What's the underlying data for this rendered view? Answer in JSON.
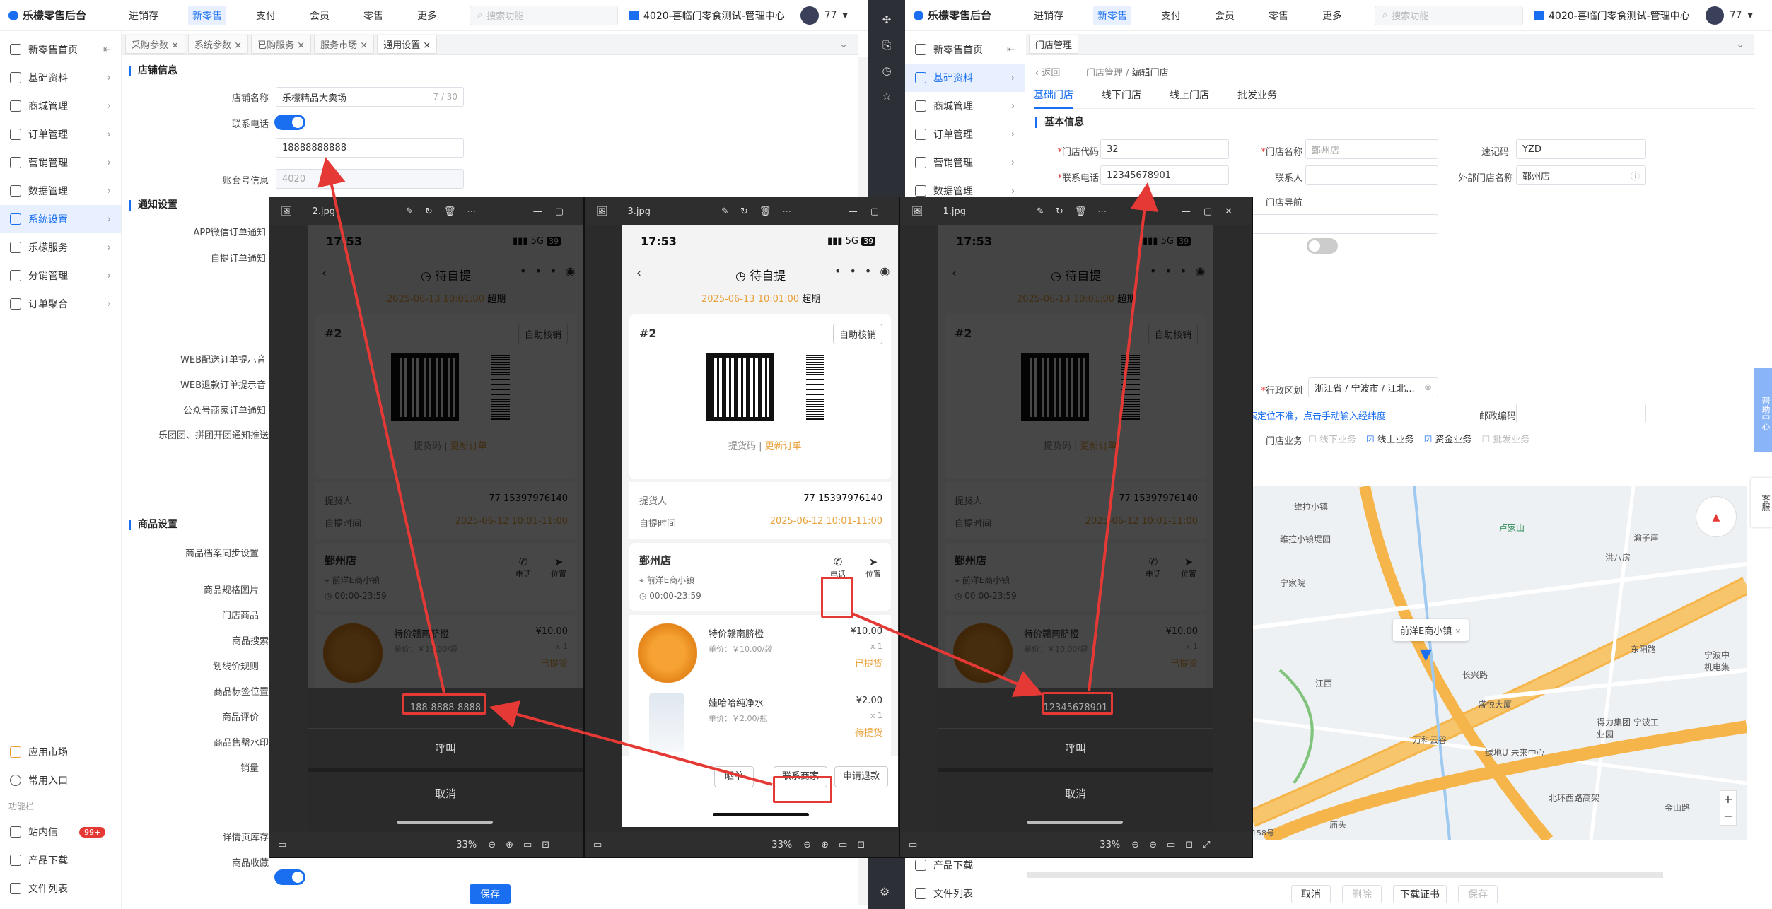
{
  "app": {
    "name": "乐檬零售后台"
  },
  "left_panel": {
    "nav": [
      "进销存",
      "新零售",
      "支付",
      "会员",
      "零售",
      "更多"
    ],
    "nav_active": 1,
    "search_placeholder": "搜索功能",
    "store": "4020-喜临门零食测试-管理中心",
    "user_count": "77",
    "sidebar": [
      "新零售首页",
      "基础资料",
      "商城管理",
      "订单管理",
      "营销管理",
      "数据管理",
      "系统设置",
      "乐檬服务",
      "分销管理",
      "订单聚合"
    ],
    "sidebar_active": 6,
    "sidebar_bottom": [
      "应用市场",
      "常用入口"
    ],
    "func_label": "功能栏",
    "func_items": [
      "站内信",
      "产品下载",
      "文件列表"
    ],
    "badge": "99+",
    "tabs": [
      "采购参数",
      "系统参数",
      "已购服务",
      "服务市场",
      "通用设置"
    ],
    "tab_active": 4,
    "section_store": "店铺信息",
    "store_name_label": "店铺名称",
    "store_name_value": "乐檬精品大卖场",
    "store_name_count": "7 / 30",
    "phone_label": "联系电话",
    "phone_value": "18888888888",
    "account_label": "账套号信息",
    "account_value": "4020",
    "section_notify": "通知设置",
    "notify_labels": [
      "APP微信订单通知",
      "自提订单通知",
      "WEB配送订单提示音",
      "WEB退款订单提示音",
      "公众号商家订单通知",
      "乐团团、拼团开团通知推送"
    ],
    "section_goods": "商品设置",
    "goods_labels": [
      "商品档案同步设置",
      "商品规格图片",
      "门店商品",
      "商品搜索",
      "划线价规则",
      "商品标签位置",
      "商品评价",
      "商品售罄水印",
      "销量",
      "详情页库存",
      "商品收藏"
    ],
    "save": "保存"
  },
  "right_panel": {
    "nav": [
      "进销存",
      "新零售",
      "支付",
      "会员",
      "零售",
      "更多"
    ],
    "nav_active": 1,
    "search_placeholder": "搜索功能",
    "store": "4020-喜临门零食测试-管理中心",
    "user_count": "77",
    "sidebar": [
      "新零售首页",
      "基础资料",
      "商城管理",
      "订单管理",
      "营销管理",
      "数据管理"
    ],
    "sidebar_active": 1,
    "func_items": [
      "产品下载",
      "文件列表"
    ],
    "tab": "门店管理",
    "back": "返回",
    "breadcrumb": [
      "门店管理",
      "编辑门店"
    ],
    "subtabs": [
      "基础门店",
      "线下门店",
      "线上门店",
      "批发业务"
    ],
    "subtab_active": 0,
    "section": "基本信息",
    "code_label": "门店代码",
    "code_value": "32",
    "name_label": "门店名称",
    "name_placeholder": "鄞州店",
    "short_label": "速记码",
    "short_value": "YZD",
    "phone_label": "联系电话",
    "phone_value": "12345678901",
    "contact_label": "联系人",
    "ext_label": "外部门店名称",
    "ext_value": "鄞州店",
    "nav_label": "门店导航",
    "region_label": "行政区划",
    "region_value": "浙江省 / 宁波市 / 江北...",
    "locate_tip": "搜索定位不准，点击手动输入经纬度",
    "postal_label": "邮政编码",
    "biz_label": "门店业务",
    "biz_options": [
      "线下业务",
      "线上业务",
      "资金业务",
      "批发业务"
    ],
    "biz_checked": [
      false,
      true,
      true,
      false
    ],
    "map_pin": "前洋E商小镇",
    "map_labels": [
      "维拉小镇",
      "维拉小镇堤园",
      "卢家山",
      "宁家院",
      "长兴路",
      "得力集团 宁波工业园",
      "盛悦大厦",
      "万科云谷",
      "绿地U 未来中心",
      "北环西路高架",
      "金山路",
      "东阳路",
      "江西",
      "宁波中 机电集",
      "渝子崖",
      "洪八房",
      "庙头",
      "158号"
    ],
    "buttons": [
      "取消",
      "删除",
      "下载证书",
      "保存"
    ],
    "side_help": [
      "帮助中心",
      "客服"
    ]
  },
  "viewers": [
    {
      "file": "2.jpg",
      "zoom": "33%",
      "dimmed": true,
      "popup_phone": "188-8888-8888",
      "call": "呼叫",
      "cancel": "取消"
    },
    {
      "file": "3.jpg",
      "zoom": "33%",
      "dimmed": false
    },
    {
      "file": "1.jpg",
      "zoom": "33%",
      "dimmed": true,
      "popup_phone": "12345678901",
      "call": "呼叫",
      "cancel": "取消"
    }
  ],
  "phone_screen": {
    "time": "17:53",
    "signal": "5G",
    "battery": "39",
    "title": "待自提",
    "pickup_time": "2025-06-13 10:01:00",
    "overdue": "超期",
    "order_no": "#2",
    "self_verify": "自助核销",
    "code_label": "提货码",
    "refresh": "更新订单",
    "picker_label": "提货人",
    "picker_value": "77  15397976140",
    "pick_time_label": "自提时间",
    "pick_time_value": "2025-06-12 10:01-11:00",
    "shop_name": "鄞州店",
    "shop_addr": "前洋E商小镇",
    "shop_hours": "00:00-23:59",
    "phone_btn": "电话",
    "locate_btn": "位置",
    "items": [
      {
        "name": "特价赣南脐橙",
        "unit": "单价：￥10.00/袋",
        "price": "¥10.00",
        "qty": "x 1",
        "status": "已提货"
      },
      {
        "name": "娃哈哈纯净水",
        "unit": "单价：￥2.00/瓶",
        "price": "¥2.00",
        "qty": "x 1",
        "status": "待提货"
      }
    ],
    "actions": [
      "晒单",
      "联系商家",
      "申请退款"
    ]
  },
  "colors": {
    "accent": "#1a6ff0",
    "annotation": "#e53935",
    "orange": "#e8a13a"
  }
}
